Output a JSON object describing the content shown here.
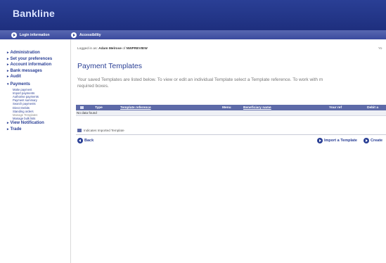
{
  "header": {
    "brand": "Bankline"
  },
  "linkbar": {
    "items": [
      {
        "label": "Login information",
        "icon": "arrow-right-icon"
      },
      {
        "label": "Accessibility",
        "icon": "arrow-right-icon"
      }
    ]
  },
  "sidebar": {
    "items": [
      {
        "label": "Administration"
      },
      {
        "label": "Set your preferences"
      },
      {
        "label": "Account information"
      },
      {
        "label": "Bank messages"
      },
      {
        "label": "Audit"
      },
      {
        "label": "Payments"
      },
      {
        "label": "View Notification"
      },
      {
        "label": "Trade"
      }
    ],
    "payments_subitems": [
      {
        "label": "Make payment"
      },
      {
        "label": "Import payments"
      },
      {
        "label": "Authorise payments"
      },
      {
        "label": "Payment summary"
      },
      {
        "label": "Search payments"
      },
      {
        "label": "Direct Debits"
      },
      {
        "label": "Standing orders"
      },
      {
        "label": "Manage Templates"
      },
      {
        "label": "Manage bulk lists"
      }
    ]
  },
  "main": {
    "logged_prefix": "Logged in as:",
    "logged_user": "Adam Melrose",
    "logged_mid": "of",
    "logged_org": "NWPREVIEW",
    "logged_right": "Yo",
    "title": "Payment Templates",
    "intro_line1": "Your saved Templates are listed below. To view or edit an individual Template select a Template reference. To work with m",
    "intro_line2": "required boxes."
  },
  "table": {
    "columns": [
      "Type",
      "Template reference",
      "Menu",
      "Beneficiary name",
      "Your ref",
      "Debit a"
    ],
    "empty_text": "No data found"
  },
  "legend": {
    "text": "Indicates Imported Template"
  },
  "actions": {
    "back": "Back",
    "import": "Import a Template",
    "create": "Create"
  },
  "colors": {
    "brand_blue": "#2a3f95",
    "linkbar_blue": "#4a58a6",
    "table_header": "#5d6aa8"
  }
}
